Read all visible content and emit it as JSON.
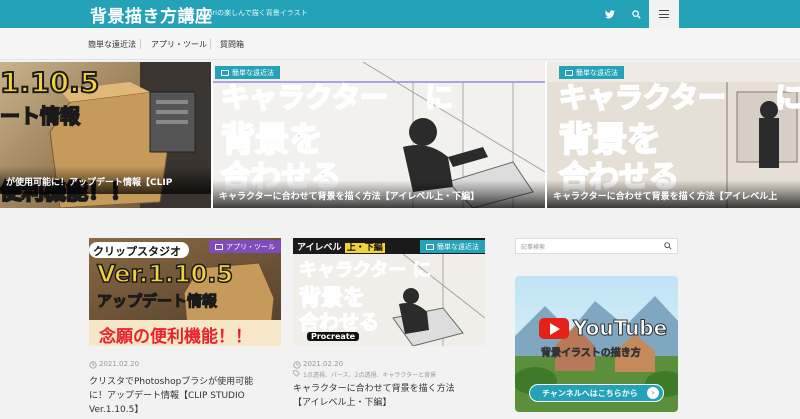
{
  "header": {
    "title": "背景描き方講座",
    "tagline": "ariの楽しんで描く背景イラスト",
    "icons": {
      "twitter": "twitter-icon",
      "search": "search-icon",
      "menu": "menu-icon"
    }
  },
  "nav": {
    "items": [
      {
        "label": "簡単な遠近法"
      },
      {
        "label": "アプリ・ツール"
      },
      {
        "label": "質問箱"
      }
    ]
  },
  "slider": {
    "slides": [
      {
        "caption": "が使用可能に！アップデート情報【CLIP",
        "badge": "",
        "art_top": "1.10.5",
        "art_mid": "ート情報",
        "art_bot": "便利機能！！"
      },
      {
        "caption": "キャラクターに合わせて背景を描く方法【アイレベル上・下編】",
        "badge": "簡単な遠近法",
        "art_top": "キャラクター",
        "art_ni": "に",
        "art_mid": "背景を",
        "art_bot": "合わせる"
      },
      {
        "caption": "キャラクターに合わせて背景を描く方法【アイレベル上",
        "badge": "簡単な遠近法",
        "art_top": "キャラクター",
        "art_ni": "に",
        "art_mid": "背景を",
        "art_bot": "合わせる"
      }
    ]
  },
  "posts": [
    {
      "badge": "アプリ・ツール",
      "thumb_top": "クリップスタジオ",
      "thumb_ver": "Ver.1.10.5",
      "thumb_sub": "アップデート情報",
      "thumb_bottom": "念願の便利機能！！",
      "date": "2021.02.20",
      "tags": "",
      "title_line1": "クリスタでPhotoshopブラシが使用可能",
      "title_line2": "に！アップデート情報【CLIP STUDIO",
      "title_line3": "Ver.1.10.5】"
    },
    {
      "badge": "簡単な遠近法",
      "thumb_top": "アイレベル",
      "thumb_tag": "上・下編",
      "thumb_kata": "キャラクター",
      "thumb_ni": "に",
      "thumb_mid": "背景を",
      "thumb_bot": "合わせる",
      "thumb_logo": "Procreate",
      "date": "2021.02.20",
      "tags": "1点透視、パース、2点透視、キャラクターと背景",
      "title_line1": "キャラクターに合わせて背景を描く方法",
      "title_line2": "【アイレベル上・下編】",
      "title_line3": ""
    }
  ],
  "sidebar": {
    "search_placeholder": "記事検索",
    "banner": {
      "logo": "YouTube",
      "subtitle": "背景イラストの描き方",
      "button": "チャンネルへはこちらから"
    }
  },
  "colors": {
    "accent": "#23a2b8",
    "purple_badge": "#7c4dbb",
    "youtube_red": "#e62117"
  }
}
